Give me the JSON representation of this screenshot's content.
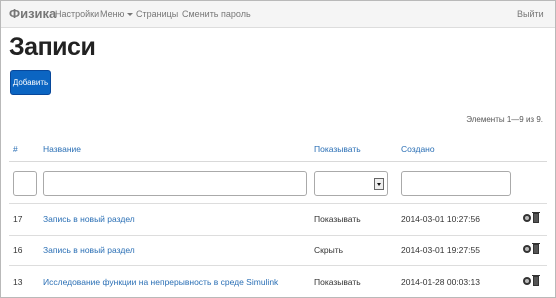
{
  "navbar": {
    "brand": "Физика",
    "items": [
      {
        "label": "Настройки"
      },
      {
        "label": "Меню"
      },
      {
        "label": "Страницы"
      },
      {
        "label": "Сменить пароль"
      }
    ],
    "logout": "Выйти"
  },
  "page": {
    "title": "Записи",
    "add_button": "Добавить",
    "summary": "Элементы 1—9 из 9."
  },
  "table": {
    "columns": [
      "#",
      "Название",
      "Показывать",
      "Создано"
    ],
    "filter_select_value": "",
    "rows": [
      {
        "id": "17",
        "title": "Запись в новый раздел",
        "visibility": "Показывать",
        "created": "2014-03-01 10:27:56"
      },
      {
        "id": "16",
        "title": "Запись в новый раздел",
        "visibility": "Скрыть",
        "created": "2014-03-01 19:27:55"
      },
      {
        "id": "13",
        "title": "Исследование функции на непрерывность в среде Simulink",
        "visibility": "Показывать",
        "created": "2014-01-28 00:03:13"
      }
    ]
  },
  "icons": {
    "view": "eye-icon",
    "delete": "trash-icon"
  }
}
